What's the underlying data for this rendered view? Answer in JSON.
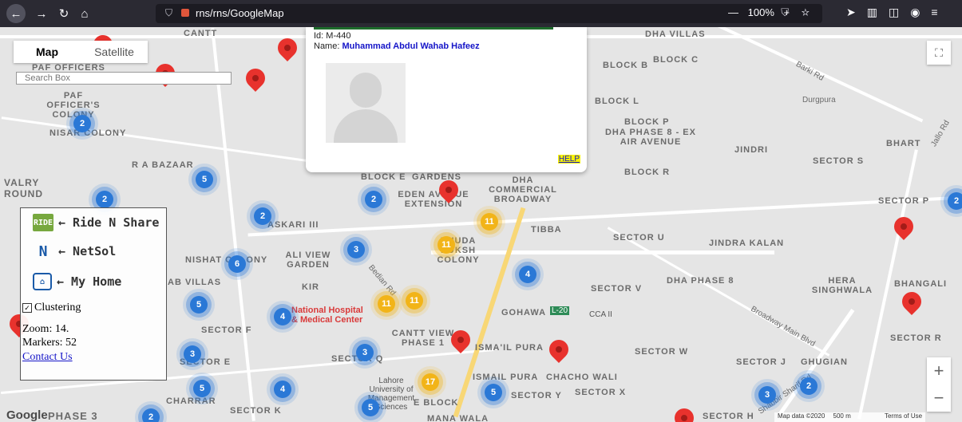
{
  "browser": {
    "url": "rns/rns/GoogleMap",
    "zoom": "100%",
    "page_actions": "··· ⛉ ☆"
  },
  "map": {
    "type_map": "Map",
    "type_satellite": "Satellite",
    "search_placeholder": "Search Box",
    "google_logo": "Google",
    "footer_data": "Map data ©2020",
    "footer_scale": "500 m",
    "footer_terms": "Terms of Use",
    "labels": [
      "CANTT",
      "PAF OFFICERS",
      "PAF OFFICER'S COLONY",
      "NISAR COLONY",
      "R A BAZAAR",
      "VALRY ROUND",
      "ASKARI III",
      "NISHAT COLONY",
      "ALI VIEW GARDEN",
      "AB VILLAS",
      "KIR",
      "SECTOR F",
      "SECTOR E",
      "SECTOR Q",
      "CHARRAR",
      "SECTOR K",
      "PHASE 3",
      "BLOCK E",
      "GARDENS",
      "EDEN AVENUE EXTENSION",
      "DHA COMMERCIAL BROADWAY",
      "TIBBA",
      "KHUDA BUKSH COLONY",
      "SECTOR U",
      "SECTOR V",
      "GOHAWA",
      "CANTT VIEW PHASE 1",
      "ISMA'IL PURA",
      "ISMAIL PURA",
      "CHACHO WALI",
      "SECTOR Y",
      "SECTOR X",
      "E BLOCK",
      "MANA WALA",
      "DHA VILLAS",
      "BLOCK B",
      "BLOCK C",
      "BLOCK L",
      "BLOCK P",
      "DHA PHASE 8 - EX AIR AVENUE",
      "BLOCK R",
      "Durgpura",
      "JINDRI",
      "SECTOR S",
      "BHART",
      "SECTOR P",
      "JINDRA KALAN",
      "DHA PHASE 8",
      "HERA SINGHWALA",
      "BHANGALI",
      "SECTOR W",
      "SECTOR J",
      "GHUGIAN",
      "SECTOR R",
      "SECTOR H",
      "Barki Rd",
      "Jallo Rd",
      "National Hospital & Medical Center",
      "Lahore University of Management Sciences",
      "CCA II",
      "L-20",
      "Bedian Rd",
      "Broadway Main Blvd",
      "Shabbir Sharif Rd"
    ]
  },
  "popup": {
    "id": "Id: M-440",
    "name_label": "Name: ",
    "name": "Muhammad Abdul Wahab Hafeez",
    "help": "HELP"
  },
  "panel": {
    "ride": "← Ride N Share",
    "netsol": "← NetSol",
    "home": "← My Home",
    "ride_icon": "RIDE",
    "netsol_icon": "N",
    "home_icon": "⌂",
    "clustering": "Clustering",
    "zoom": "Zoom: 14.",
    "markers": "Markers: 52",
    "contact": "Contact Us"
  },
  "clusters": [
    "2",
    "2",
    "5",
    "2",
    "2",
    "2",
    "6",
    "11",
    "11",
    "11",
    "11",
    "3",
    "4",
    "5",
    "4",
    "3",
    "3",
    "17",
    "5",
    "4",
    "5",
    "5",
    "3",
    "2",
    "2"
  ]
}
